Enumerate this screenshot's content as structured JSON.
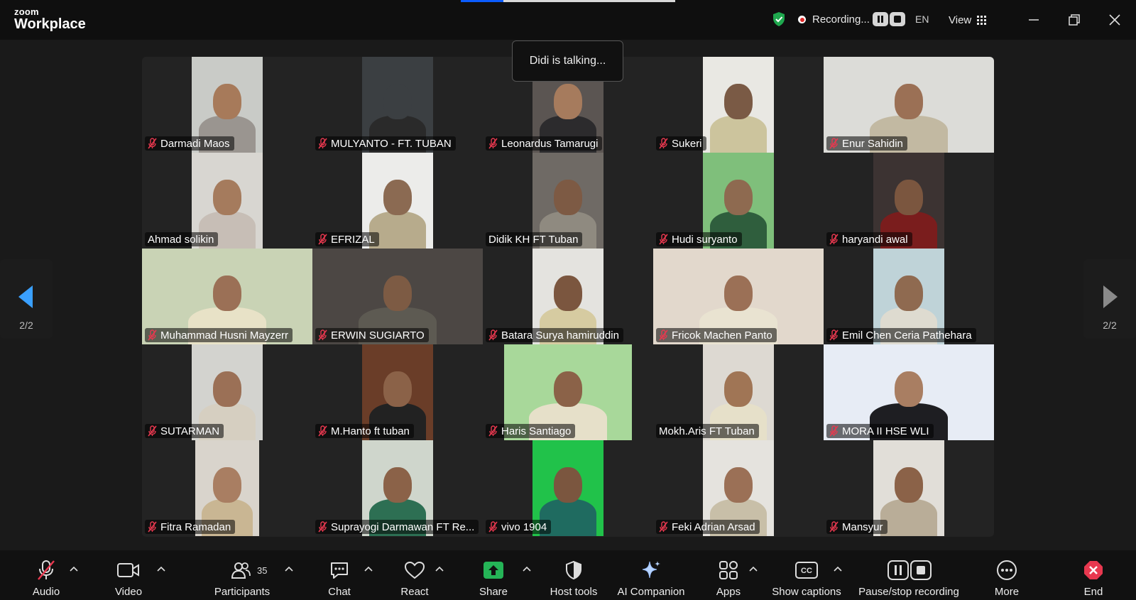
{
  "app": {
    "brand_small": "zoom",
    "brand_big": "Workplace"
  },
  "topbar": {
    "progress_fraction": 0.2,
    "recording_label": "Recording...",
    "language": "EN",
    "view_label": "View"
  },
  "talking_indicator": "Didi is talking...",
  "pagination": {
    "left_page": "2/2",
    "right_page": "2/2"
  },
  "participants": [
    {
      "name": "Darmadi Maos",
      "muted": true,
      "bg": "#c9cbc7",
      "shirt": "#9a9590",
      "skin": "#a77a5a"
    },
    {
      "name": "MULYANTO - FT. TUBAN",
      "muted": true,
      "bg": "#3b3f42",
      "shirt": "#2a2a2a",
      "skin": "#3b3f42"
    },
    {
      "name": "Leonardus Tamarugi",
      "muted": true,
      "bg": "#5b5552",
      "shirt": "#2c2b2d",
      "skin": "#a67b5d"
    },
    {
      "name": "Sukeri",
      "muted": true,
      "bg": "#e9e8e3",
      "shirt": "#ccc49d",
      "skin": "#7a5a45"
    },
    {
      "name": "Enur Sahidin",
      "muted": true,
      "bg": "#dcdcd8",
      "shirt": "#c2b9a2",
      "skin": "#9b7055"
    },
    {
      "name": "Ahmad solikin",
      "muted": false,
      "bg": "#d8d6d1",
      "shirt": "#c7beb6",
      "skin": "#a57b5d"
    },
    {
      "name": "EFRIZAL",
      "muted": true,
      "bg": "#ececea",
      "shirt": "#b7ab8c",
      "skin": "#8b6a52"
    },
    {
      "name": "Didik KH FT Tuban",
      "muted": false,
      "bg": "#6f6a65",
      "shirt": "#8f8a80",
      "skin": "#7d5a44"
    },
    {
      "name": "Hudi suryanto",
      "muted": true,
      "bg": "#7fbf7b",
      "shirt": "#2f5e3d",
      "skin": "#8e6a50"
    },
    {
      "name": "haryandi awal",
      "muted": true,
      "bg": "#3c3332",
      "shirt": "#7a1d1d",
      "skin": "#7b563f"
    },
    {
      "name": "Muhammad Husni Mayzerr",
      "muted": true,
      "bg": "#c9d3b5",
      "shirt": "#e8e2c7",
      "skin": "#9b7056"
    },
    {
      "name": "ERWIN SUGIARTO",
      "muted": true,
      "bg": "#4c4744",
      "shirt": "#5d5a52",
      "skin": "#7d5b44"
    },
    {
      "name": "Batara Surya hamiruddin",
      "muted": true,
      "bg": "#e4e3df",
      "shirt": "#d6cba1",
      "skin": "#7b563f"
    },
    {
      "name": "Fricok Machen Panto",
      "muted": true,
      "bg": "#e2d8cc",
      "shirt": "#e9e3d1",
      "skin": "#9b7056"
    },
    {
      "name": "Emil Chen Ceria Pathehara",
      "muted": true,
      "bg": "#bfd3d8",
      "shirt": "#dedbd0",
      "skin": "#8f6a50"
    },
    {
      "name": "SUTARMAN",
      "muted": true,
      "bg": "#d3d3cf",
      "shirt": "#d6cfc1",
      "skin": "#9b7056"
    },
    {
      "name": "M.Hanto ft tuban",
      "muted": true,
      "bg": "#6a3d28",
      "shirt": "#222",
      "skin": "#8b6248"
    },
    {
      "name": "Haris Santiago",
      "muted": true,
      "bg": "#a8d89a",
      "shirt": "#e6e0c9",
      "skin": "#8b6248"
    },
    {
      "name": "Mokh.Aris FT Tuban",
      "muted": false,
      "bg": "#ddd9d2",
      "shirt": "#e6e0c9",
      "skin": "#a07555"
    },
    {
      "name": "MORA II HSE WLI",
      "muted": true,
      "bg": "#e7ecf5",
      "shirt": "#1e1e22",
      "skin": "#a97e62"
    },
    {
      "name": "Fitra Ramadan",
      "muted": true,
      "bg": "#d9d4cc",
      "shirt": "#c9b693",
      "skin": "#a97e62"
    },
    {
      "name": "Suprayogi Darmawan FT Re...",
      "muted": true,
      "bg": "#cfd6cc",
      "shirt": "#2d6f53",
      "skin": "#8b6248"
    },
    {
      "name": "vivo 1904",
      "muted": true,
      "bg": "#21c24a",
      "shirt": "#1f6b60",
      "skin": "#7b563f"
    },
    {
      "name": "Feki Adrian Arsad",
      "muted": true,
      "bg": "#e5e3de",
      "shirt": "#c8bfa8",
      "skin": "#9b7056"
    },
    {
      "name": "Mansyur",
      "muted": true,
      "bg": "#e1ded8",
      "shirt": "#b9ad98",
      "skin": "#8b6248"
    }
  ],
  "toolbar": {
    "audio": "Audio",
    "video": "Video",
    "participants": "Participants",
    "participants_count": "35",
    "chat": "Chat",
    "react": "React",
    "share": "Share",
    "host_tools": "Host tools",
    "ai_companion": "AI Companion",
    "apps": "Apps",
    "show_captions": "Show captions",
    "pause_stop_recording": "Pause/stop recording",
    "more": "More",
    "end": "End"
  },
  "colors": {
    "share_green": "#25b457",
    "end_red": "#e8384f",
    "shield_green": "#1fa84e",
    "accent_blue": "#0b5cff"
  }
}
